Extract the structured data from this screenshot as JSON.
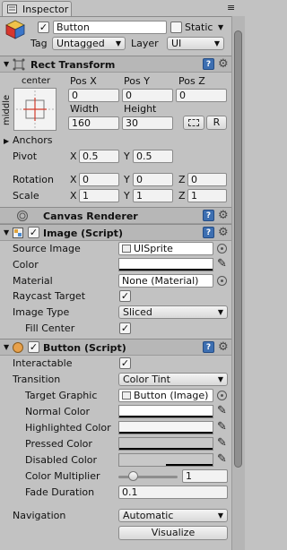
{
  "window": {
    "tab_title": "Inspector"
  },
  "object": {
    "name": "Button",
    "active": true,
    "static_label": "Static",
    "tag_label": "Tag",
    "tag_value": "Untagged",
    "layer_label": "Layer",
    "layer_value": "UI"
  },
  "rect_transform": {
    "title": "Rect Transform",
    "anchor_h": "center",
    "anchor_v": "middle",
    "pos_x_label": "Pos X",
    "pos_y_label": "Pos Y",
    "pos_z_label": "Pos Z",
    "pos_x": "0",
    "pos_y": "0",
    "pos_z": "0",
    "width_label": "Width",
    "height_label": "Height",
    "width": "160",
    "height": "30",
    "raw_button": "R",
    "anchors_label": "Anchors",
    "pivot_label": "Pivot",
    "pivot_x": "0.5",
    "pivot_y": "0.5",
    "rotation_label": "Rotation",
    "rot_x": "0",
    "rot_y": "0",
    "rot_z": "0",
    "scale_label": "Scale",
    "scale_x": "1",
    "scale_y": "1",
    "scale_z": "1",
    "axis_x": "X",
    "axis_y": "Y",
    "axis_z": "Z"
  },
  "canvas_renderer": {
    "title": "Canvas Renderer"
  },
  "image": {
    "title": "Image (Script)",
    "enabled": true,
    "source_image_label": "Source Image",
    "source_image": "UISprite",
    "color_label": "Color",
    "material_label": "Material",
    "material": "None (Material)",
    "raycast_label": "Raycast Target",
    "raycast": true,
    "image_type_label": "Image Type",
    "image_type": "Sliced",
    "fill_center_label": "Fill Center",
    "fill_center": true
  },
  "button": {
    "title": "Button (Script)",
    "enabled": true,
    "interactable_label": "Interactable",
    "interactable": true,
    "transition_label": "Transition",
    "transition": "Color Tint",
    "target_graphic_label": "Target Graphic",
    "target_graphic": "Button (Image)",
    "normal_color_label": "Normal Color",
    "highlighted_color_label": "Highlighted Color",
    "pressed_color_label": "Pressed Color",
    "disabled_color_label": "Disabled Color",
    "color_multiplier_label": "Color Multiplier",
    "color_multiplier": "1",
    "color_multiplier_fraction": 0.2,
    "fade_duration_label": "Fade Duration",
    "fade_duration": "0.1",
    "navigation_label": "Navigation",
    "navigation": "Automatic",
    "visualize_label": "Visualize"
  },
  "colors": {
    "normal": "#ffffff",
    "highlighted": "#f5f5f5",
    "pressed": "#c8c8c8",
    "disabled": "#c8c8c8"
  },
  "icons": {
    "tab": "inspector-icon",
    "object": "cube-icon",
    "help": "help-icon",
    "settings": "gear-icon",
    "object_picker": "object-picker-icon",
    "eyedropper": "eyedropper-icon"
  },
  "glyphs": {
    "check": "✓",
    "help": "?",
    "gear": "⚙",
    "dropdown": "▼",
    "fold_open": "▼",
    "fold_closed": "▶",
    "picker": "✎",
    "menu": "≡"
  }
}
